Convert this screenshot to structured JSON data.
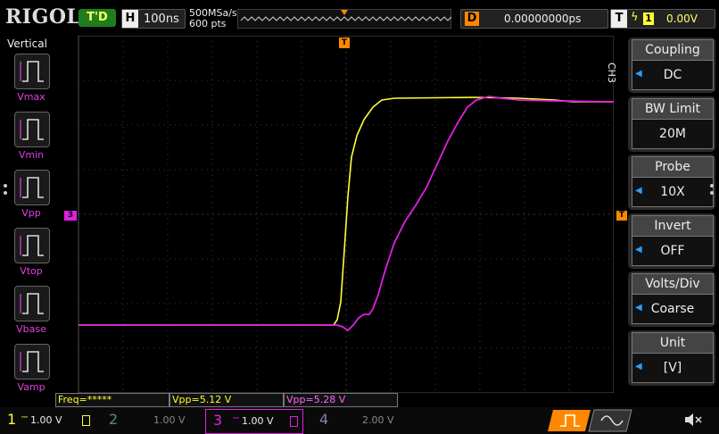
{
  "top": {
    "brand": "RIGOL",
    "run_status": "T'D",
    "timebase_key": "H",
    "timebase": "100ns",
    "sample_rate": "500MSa/s",
    "mem_depth": "600  pts",
    "delay_key": "D",
    "delay_value": "0.00000000ps",
    "trigger_key": "T",
    "trigger_source": "1",
    "trigger_level": "0.00V"
  },
  "left_panel": {
    "title": "Vertical",
    "items": [
      "Vmax",
      "Vmin",
      "Vpp",
      "Vtop",
      "Vbase",
      "Vamp"
    ]
  },
  "menu": {
    "channel": "CH3",
    "items": [
      {
        "label": "Coupling",
        "value": "DC"
      },
      {
        "label": "BW Limit",
        "value": "20M"
      },
      {
        "label": "Probe",
        "value": "10X"
      },
      {
        "label": "Invert",
        "value": "OFF"
      },
      {
        "label": "Volts/Div",
        "value": "Coarse"
      },
      {
        "label": "Unit",
        "value": "[V]"
      }
    ]
  },
  "measurements": {
    "freq": "Freq=*****",
    "vpp1": "Vpp=5.12 V",
    "vpp3": "Vpp=5.28 V"
  },
  "channels": [
    {
      "num": "1",
      "scale": "1.00 V",
      "color": "#ffff33"
    },
    {
      "num": "2",
      "scale": "1.00 V",
      "color": "#00c0c0"
    },
    {
      "num": "3",
      "scale": "1.00 V",
      "color": "#e000e0"
    },
    {
      "num": "4",
      "scale": "2.00 V",
      "color": "#3366ff"
    }
  ],
  "markers": {
    "trigger": "T",
    "ch3": "3"
  }
}
